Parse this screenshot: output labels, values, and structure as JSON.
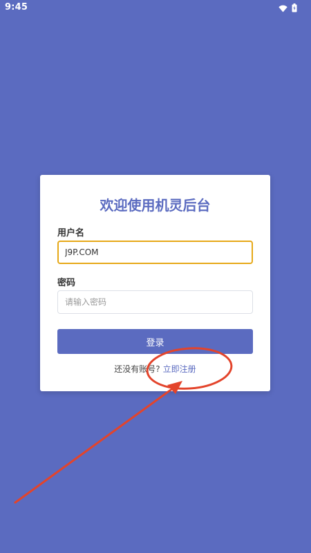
{
  "status_bar": {
    "time": "9:45",
    "icons": [
      "wifi-icon",
      "battery-icon"
    ]
  },
  "login": {
    "title": "欢迎使用机灵后台",
    "username_label": "用户名",
    "username_value": "J9P.COM",
    "password_label": "密码",
    "password_placeholder": "请输入密码",
    "submit_label": "登录",
    "register_prompt": "还没有账号?",
    "register_link": "立即注册"
  },
  "colors": {
    "background": "#5B6BC0",
    "accent": "#5B6BC0",
    "focus_border": "#E6A817",
    "annotation": "#E3442B"
  }
}
